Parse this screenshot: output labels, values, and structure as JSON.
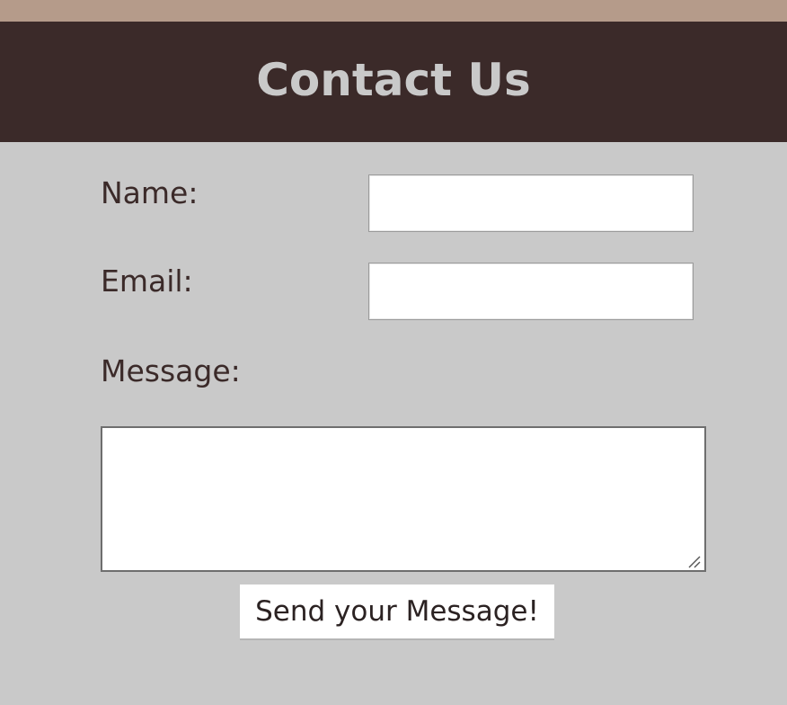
{
  "header": {
    "title": "Contact Us"
  },
  "form": {
    "name_label": "Name:",
    "name_value": "",
    "email_label": "Email:",
    "email_value": "",
    "message_label": "Message:",
    "message_value": "",
    "submit_label": "Send your Message!"
  },
  "colors": {
    "top_strip": "#b59b8a",
    "header_bg": "#3b2a29",
    "header_text": "#c9c9c9",
    "page_bg": "#c9c9c9",
    "label_text": "#3b2a29"
  },
  "icons": {
    "resize_grip": "resize-grip-icon"
  }
}
